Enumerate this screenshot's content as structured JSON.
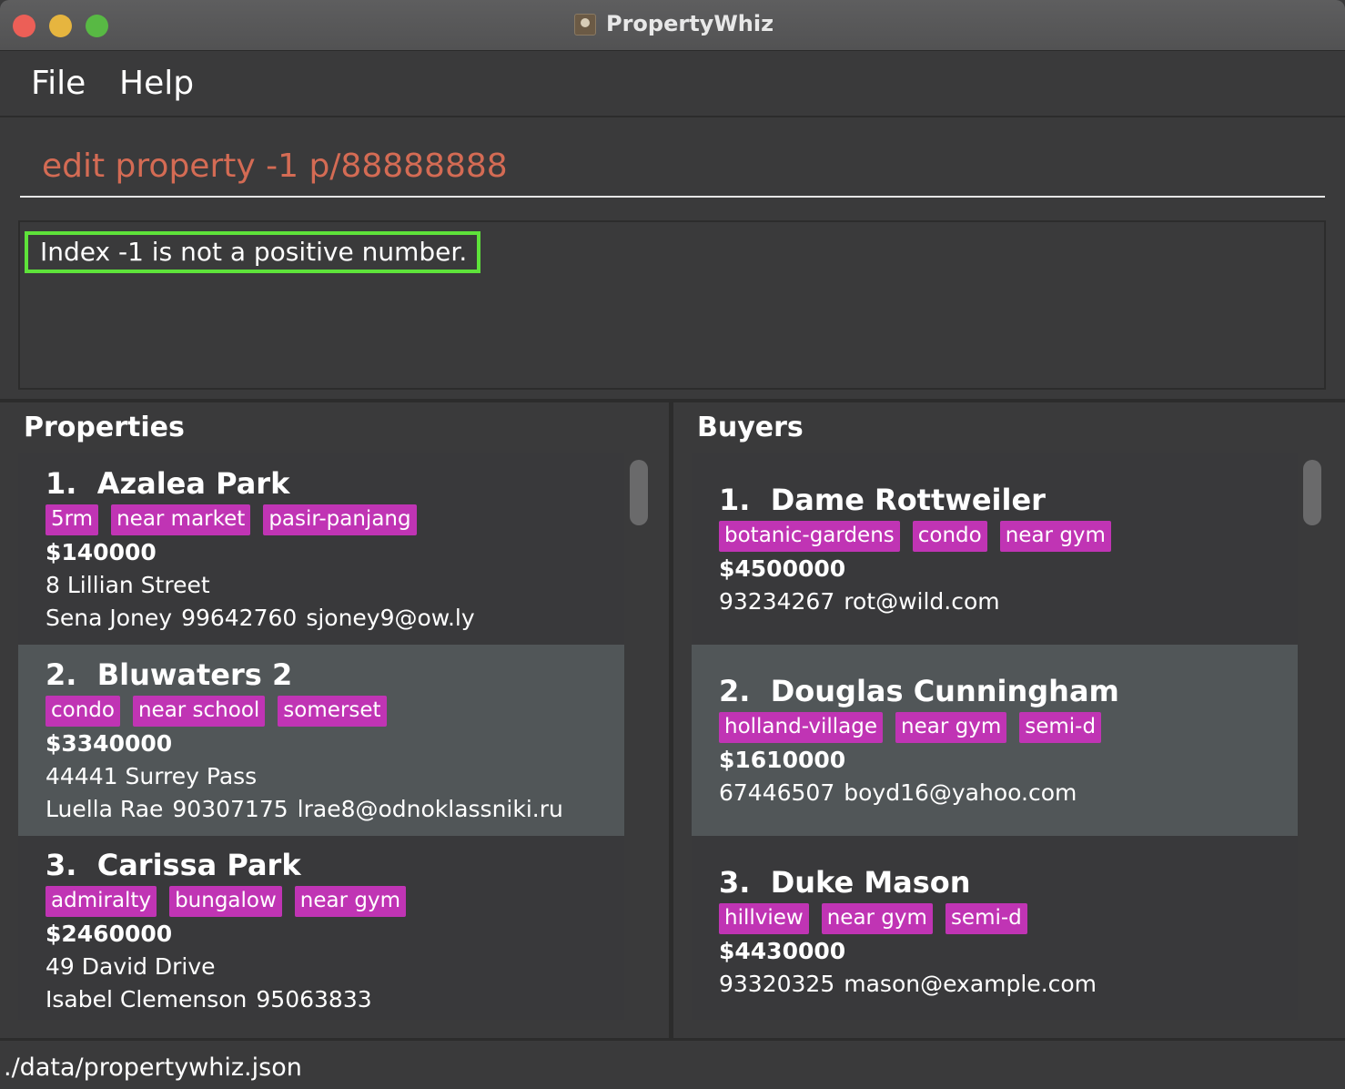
{
  "window": {
    "title": "PropertyWhiz"
  },
  "menu": {
    "file": "File",
    "help": "Help"
  },
  "command": {
    "value": "edit property -1 p/88888888"
  },
  "result": {
    "message": "Index -1 is not a positive number."
  },
  "properties": {
    "title": "Properties",
    "items": [
      {
        "index": "1.",
        "name": "Azalea Park",
        "tags": [
          "5rm",
          "near market",
          "pasir-panjang"
        ],
        "price": "$140000",
        "address": "8 Lillian Street",
        "owner": "Sena Joney",
        "phone": "99642760",
        "email": "sjoney9@ow.ly"
      },
      {
        "index": "2.",
        "name": "Bluwaters 2",
        "tags": [
          "condo",
          "near school",
          "somerset"
        ],
        "price": "$3340000",
        "address": "44441 Surrey Pass",
        "owner": "Luella Rae",
        "phone": "90307175",
        "email": "lrae8@odnoklassniki.ru"
      },
      {
        "index": "3.",
        "name": "Carissa Park",
        "tags": [
          "admiralty",
          "bungalow",
          "near gym"
        ],
        "price": "$2460000",
        "address": "49 David Drive",
        "owner": "Isabel Clemenson",
        "phone": "95063833",
        "email": ""
      }
    ]
  },
  "buyers": {
    "title": "Buyers",
    "items": [
      {
        "index": "1.",
        "name": "Dame Rottweiler",
        "tags": [
          "botanic-gardens",
          "condo",
          "near gym"
        ],
        "price": "$4500000",
        "phone": "93234267",
        "email": "rot@wild.com"
      },
      {
        "index": "2.",
        "name": "Douglas Cunningham",
        "tags": [
          "holland-village",
          "near gym",
          "semi-d"
        ],
        "price": "$1610000",
        "phone": "67446507",
        "email": "boyd16@yahoo.com"
      },
      {
        "index": "3.",
        "name": "Duke Mason",
        "tags": [
          "hillview",
          "near gym",
          "semi-d"
        ],
        "price": "$4430000",
        "phone": "93320325",
        "email": "mason@example.com"
      }
    ]
  },
  "status": {
    "path": "./data/propertywhiz.json"
  },
  "colors": {
    "tag": "#c034b4",
    "command_text": "#d46b54",
    "result_highlight": "#5ee23a",
    "selected_card": "#515658"
  }
}
